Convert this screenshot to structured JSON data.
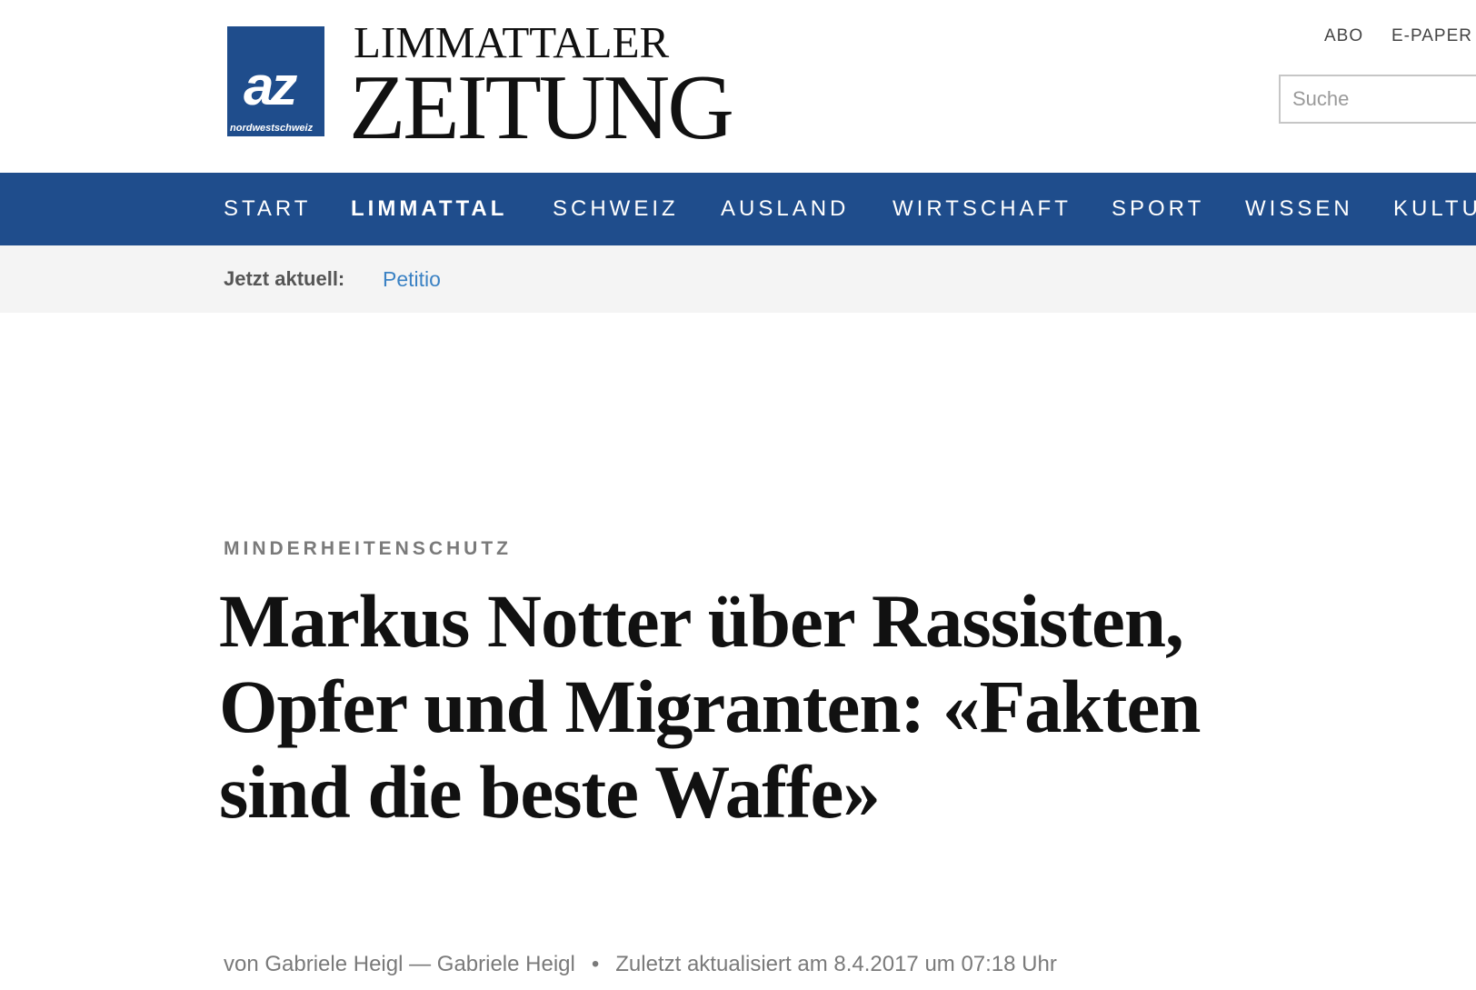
{
  "header": {
    "logo": {
      "mark": "az",
      "subtext": "nordwestschweiz"
    },
    "brand_line1": "LIMMATTALER",
    "brand_line2": "ZEITUNG",
    "links": [
      "ABO",
      "E-PAPER"
    ],
    "search_placeholder": "Suche"
  },
  "nav": {
    "items": [
      "START",
      "LIMMATTAL",
      "SCHWEIZ",
      "AUSLAND",
      "WIRTSCHAFT",
      "SPORT",
      "WISSEN",
      "KULTU"
    ],
    "active": "LIMMATTAL"
  },
  "ticker": {
    "label": "Jetzt aktuell:",
    "link": "Petitio"
  },
  "article": {
    "kicker": "MINDERHEITENSCHUTZ",
    "headline": "Markus Notter über Rassisten, Opfer und Migranten: «Fakten sind die beste Waffe»",
    "byline": "von Gabriele Heigl — Gabriele Heigl",
    "separator": "•",
    "updated": "Zuletzt aktualisiert am 8.4.2017 um 07:18 Uhr"
  },
  "colors": {
    "brand_blue": "#1f4d8c",
    "link_blue": "#3b82c4",
    "ticker_bg": "#f4f4f4"
  }
}
